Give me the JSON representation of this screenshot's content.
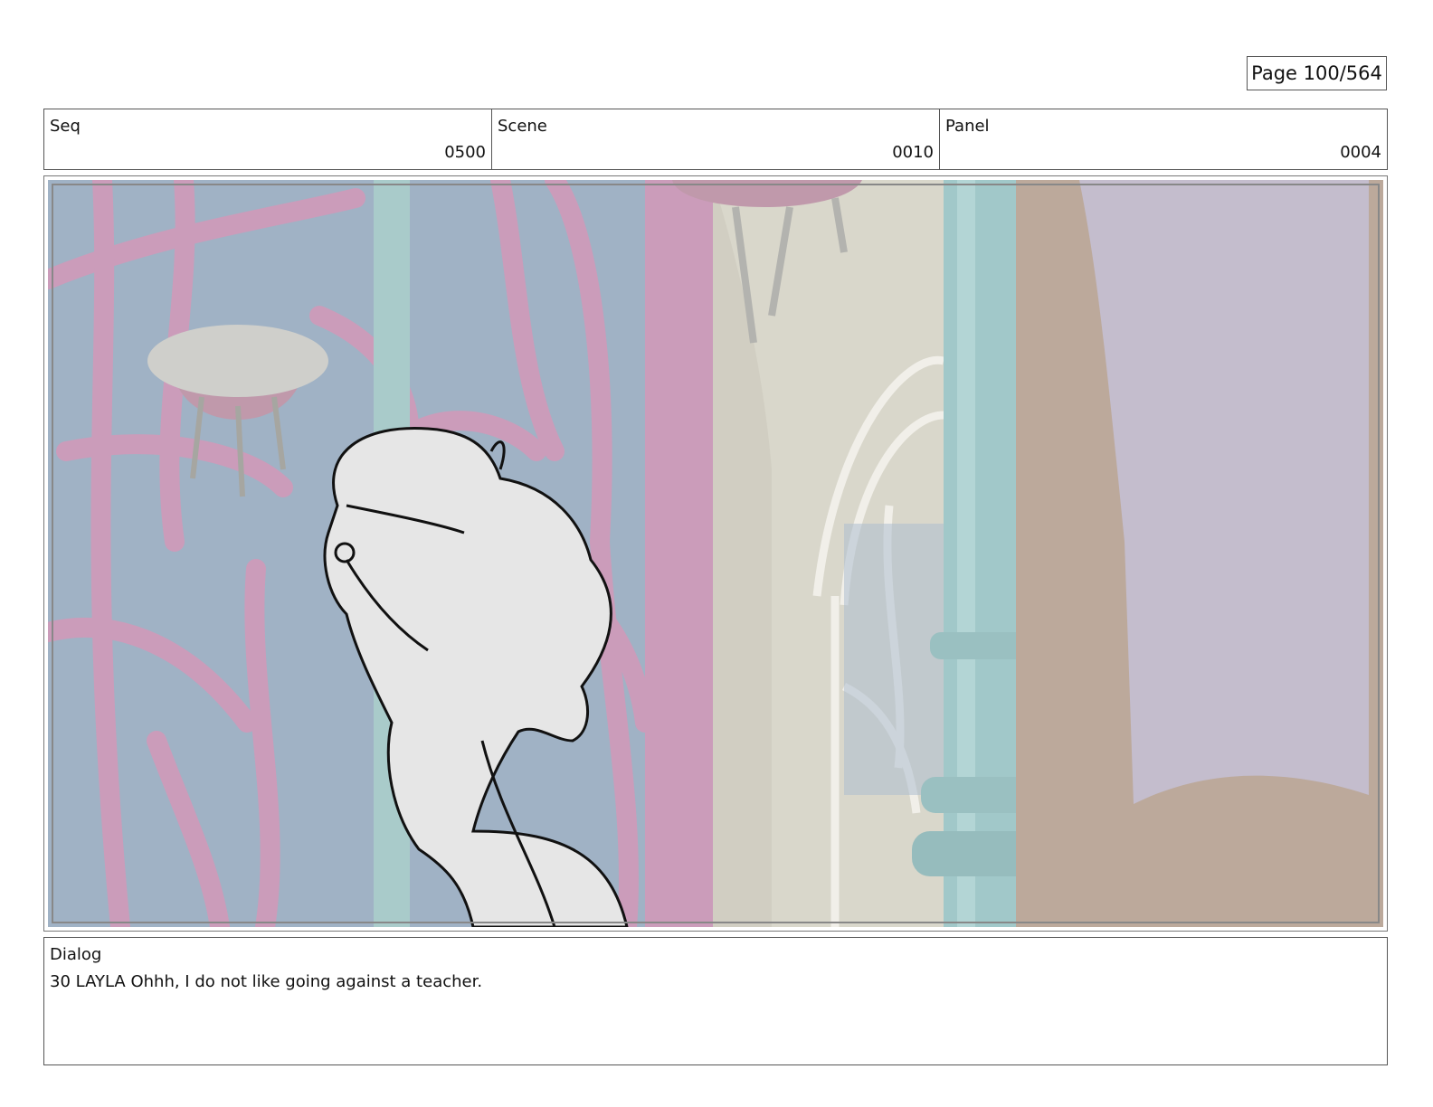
{
  "page": {
    "label": "Page 100/564"
  },
  "header": {
    "seq": {
      "label": "Seq",
      "value": "0500"
    },
    "scene": {
      "label": "Scene",
      "value": "0010"
    },
    "panel": {
      "label": "Panel",
      "value": "0004"
    }
  },
  "dialog": {
    "label": "Dialog",
    "text": "30 LAYLA Ohhh, I do not like going against a teacher."
  },
  "colors": {
    "sky": "#93a8bd",
    "pink_frame": "#c48fb1",
    "teal_column": "#95c1c2",
    "wall": "#d4d2c4",
    "mirror_frame": "#b39e8e",
    "mirror_glass": "#bcb4c6",
    "sketch_fill": "#e6e6e6"
  }
}
